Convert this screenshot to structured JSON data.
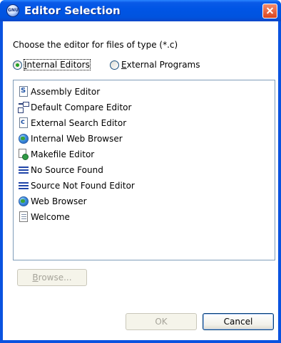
{
  "window": {
    "title": "Editor Selection",
    "app_icon_text": "GNU"
  },
  "prompt": "Choose the editor for files of type (*.c)",
  "options": {
    "internal": {
      "mnemonic": "I",
      "rest": "nternal Editors",
      "selected": true
    },
    "external": {
      "mnemonic": "E",
      "rest": "xternal Programs",
      "selected": false
    }
  },
  "editors": [
    {
      "label": "Assembly Editor",
      "icon": "assembly-file-icon",
      "letter": "S"
    },
    {
      "label": "Default Compare Editor",
      "icon": "compare-icon"
    },
    {
      "label": "External Search Editor",
      "icon": "c-file-icon",
      "letter": "c"
    },
    {
      "label": "Internal Web Browser",
      "icon": "globe-icon"
    },
    {
      "label": "Makefile Editor",
      "icon": "makefile-icon"
    },
    {
      "label": "No Source Found",
      "icon": "text-lines-icon"
    },
    {
      "label": "Source Not Found Editor",
      "icon": "text-lines-icon"
    },
    {
      "label": "Web Browser",
      "icon": "globe-icon"
    },
    {
      "label": "Welcome",
      "icon": "document-icon"
    }
  ],
  "buttons": {
    "browse": {
      "mnemonic": "B",
      "rest": "rowse..."
    },
    "ok": "OK",
    "cancel": "Cancel"
  },
  "colors": {
    "title_bar": "#0055e5",
    "close_button": "#e0552c",
    "radio_selected": "#21a121",
    "list_border": "#7f9db9"
  }
}
